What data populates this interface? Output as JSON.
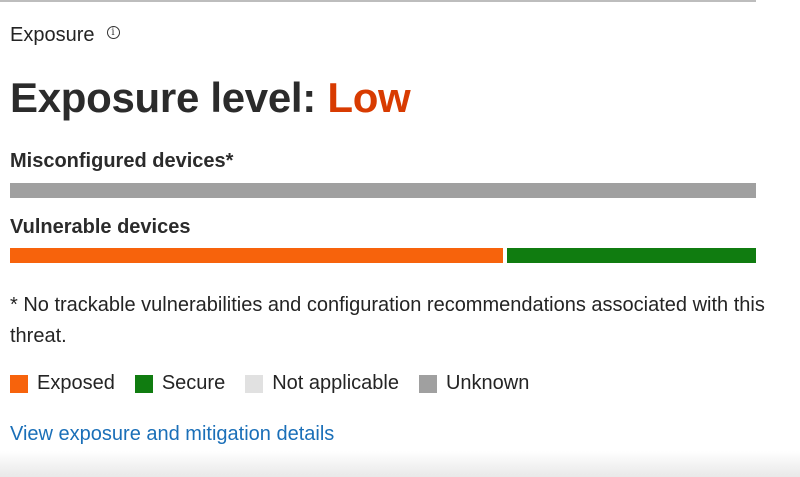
{
  "colors": {
    "exposed": "#f7630c",
    "secure": "#107c10",
    "not_applicable": "#e1e1e1",
    "unknown": "#a0a0a0",
    "level_low": "#d83b01",
    "link": "#1a6fb8"
  },
  "section": {
    "title": "Exposure",
    "info_icon": "info-icon"
  },
  "exposure": {
    "label": "Exposure level:",
    "value": "Low"
  },
  "misconfigured": {
    "label": "Misconfigured devices*",
    "segments": [
      {
        "status": "unknown",
        "fraction": 1.0
      }
    ]
  },
  "vulnerable": {
    "label": "Vulnerable devices",
    "segments": [
      {
        "status": "exposed",
        "fraction": 0.665
      },
      {
        "status": "secure",
        "fraction": 0.335
      }
    ]
  },
  "footnote": "* No trackable vulnerabilities and configuration recommendations associated with this threat.",
  "legend": [
    {
      "label": "Exposed",
      "status": "exposed"
    },
    {
      "label": "Secure",
      "status": "secure"
    },
    {
      "label": "Not applicable",
      "status": "not_applicable"
    },
    {
      "label": "Unknown",
      "status": "unknown"
    }
  ],
  "link": {
    "label": "View exposure and mitigation details"
  }
}
